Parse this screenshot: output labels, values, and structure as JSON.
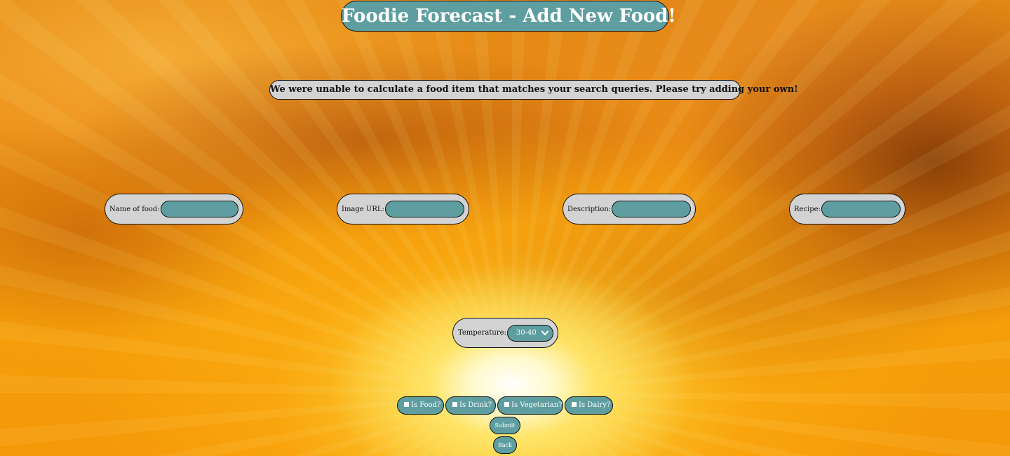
{
  "header": {
    "title": "Foodie Forecast - Add New Food!"
  },
  "message": "We were unable to calculate a food item that matches your search queries. Please try adding your own!",
  "form": {
    "fields": [
      {
        "label": "Name of food:",
        "value": ""
      },
      {
        "label": "Image URL:",
        "value": ""
      },
      {
        "label": "Description:",
        "value": ""
      },
      {
        "label": "Recipe:",
        "value": ""
      }
    ],
    "temperature": {
      "label": "Temperature:",
      "selected": "30-40"
    },
    "checkboxes": [
      {
        "label": "Is Food?",
        "checked": false
      },
      {
        "label": "Is Drink?",
        "checked": false
      },
      {
        "label": "Is Vegetarian?",
        "checked": false
      },
      {
        "label": "Is Dairy?",
        "checked": false
      }
    ],
    "submit_label": "Submit",
    "back_label": "Back"
  },
  "colors": {
    "accent": "#5f9ea0",
    "panel": "#d3d3d3",
    "sky_orange": "#f0970c"
  },
  "icons": {
    "select_arrow": "chevron-down-icon",
    "checkbox": "checkbox-icon"
  }
}
